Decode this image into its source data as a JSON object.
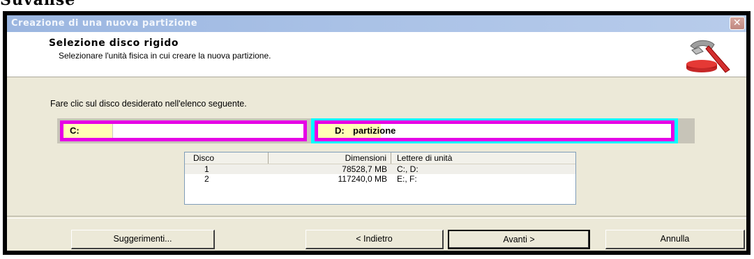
{
  "corner": {
    "text": "Suvanse"
  },
  "window": {
    "title": "Creazione di una nuova partizione",
    "close_icon": "close-icon"
  },
  "header": {
    "title": "Selezione disco rigido",
    "subtitle": "Selezionare l'unità fisica in cui creare la nuova partizione.",
    "icon": "hammer-disk-icon"
  },
  "instruction": "Fare clic sul disco desiderato nell'elenco seguente.",
  "disk_map": {
    "partitions": [
      {
        "label": "C:",
        "name": ""
      },
      {
        "label": "D:",
        "name": "partizione"
      }
    ],
    "colors": {
      "partition_border": "#e600e6",
      "selected_outline": "#00ffff",
      "used_fill": "#ffffb4"
    }
  },
  "disk_list": {
    "columns": [
      "Disco",
      "Dimensioni",
      "Lettere di unità"
    ],
    "rows": [
      {
        "disk": "1",
        "size": "78528,7 MB",
        "letters": "C:, D:"
      },
      {
        "disk": "2",
        "size": "117240,0 MB",
        "letters": "E:, F:"
      }
    ]
  },
  "buttons": {
    "hints": "Suggerimenti...",
    "back": "< Indietro",
    "next": "Avanti >",
    "cancel": "Annulla"
  }
}
